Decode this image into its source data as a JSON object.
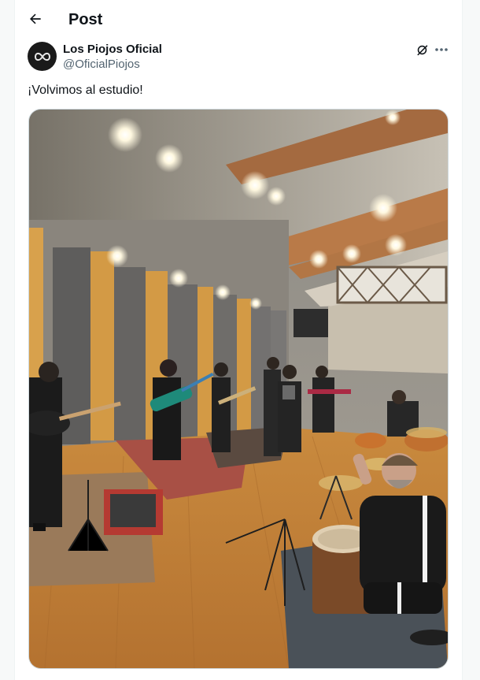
{
  "header": {
    "title": "Post",
    "back_icon": "arrow-left-icon"
  },
  "author": {
    "display_name": "Los Piojos Oficial",
    "handle": "@OficialPiojos",
    "avatar_icon": "infinity-logo-icon"
  },
  "actions": {
    "grok_icon": "grok-icon",
    "more_icon": "more-horizontal-icon"
  },
  "tweet": {
    "text": "¡Volvimos al estudio!"
  },
  "colors": {
    "text": "#0f1419",
    "secondary": "#536471",
    "border": "#eff3f4",
    "page_bg": "#f7f9f9"
  }
}
